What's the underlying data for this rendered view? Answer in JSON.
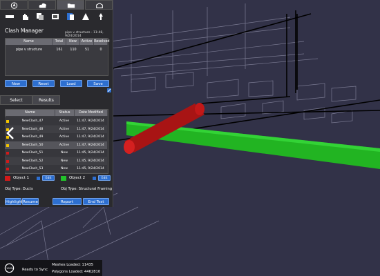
{
  "toolbar": {
    "tabs": [
      {
        "icon": "navigate-icon",
        "active": false
      },
      {
        "icon": "cloud-icon",
        "active": false
      },
      {
        "icon": "folder-icon",
        "active": true
      },
      {
        "icon": "home-icon",
        "active": false
      }
    ],
    "tools": [
      "ruler-icon",
      "hand-icon",
      "copy-icon",
      "layers-icon",
      "section-icon",
      "cone-icon",
      "tree-icon"
    ]
  },
  "clash_manager": {
    "title": "Clash Manager",
    "subtitle": "pipe v structure - 11:48, 9/24/2014",
    "summary_columns": [
      "Name",
      "Total",
      "New",
      "Active",
      "Resolved"
    ],
    "summary_rows": [
      [
        "pipe v structure",
        "161",
        "110",
        "51",
        "0"
      ]
    ],
    "buttons": {
      "new": "New",
      "reset": "Reset",
      "load": "Load",
      "save": "Save"
    },
    "tabs": {
      "select": "Select",
      "results": "Results"
    },
    "results_columns": [
      "Name",
      "Status",
      "Date Modified"
    ],
    "results_rows": [
      {
        "name": "NewClash_47",
        "status": "Active",
        "date": "11:47, 9/24/2014",
        "color": "#f2c400"
      },
      {
        "name": "NewClash_48",
        "status": "Active",
        "date": "11:47, 9/24/2014",
        "color": "#f2c400"
      },
      {
        "name": "NewClash_49",
        "status": "Active",
        "date": "11:47, 9/24/2014",
        "color": "#f2c400"
      },
      {
        "name": "NewClash_50",
        "status": "Active",
        "date": "11:47, 9/24/2014",
        "color": "#f2c400"
      },
      {
        "name": "NewClash_51",
        "status": "New",
        "date": "11:45, 9/24/2014",
        "color": "#d21a1a"
      },
      {
        "name": "NewClash_52",
        "status": "New",
        "date": "11:45, 9/24/2014",
        "color": "#d21a1a"
      },
      {
        "name": "NewClash_53",
        "status": "New",
        "date": "11:45, 9/24/2014",
        "color": "#d21a1a"
      }
    ],
    "object1": {
      "label": "Object 1",
      "edit": "Edit",
      "color": "#d21a1a",
      "type": "Obj Type: Ducts"
    },
    "object2": {
      "label": "Object 2",
      "edit": "Edit",
      "color": "#22c22a",
      "type": "Obj Type: Structural Framing"
    },
    "bottom_buttons": {
      "highlight": "Highlight",
      "resume": "Resume",
      "report": "Report",
      "end_test": "End Test"
    }
  },
  "status": {
    "progress_label": "100%",
    "sync_text": "Ready to Sync",
    "meshes": "Meshes Loaded: 11435",
    "polygons": "Polygons Loaded: 4462810"
  },
  "colors": {
    "accent": "#2d6fd0",
    "clash_pipe": "#b01818",
    "beam": "#22b422",
    "background": "#323248"
  }
}
